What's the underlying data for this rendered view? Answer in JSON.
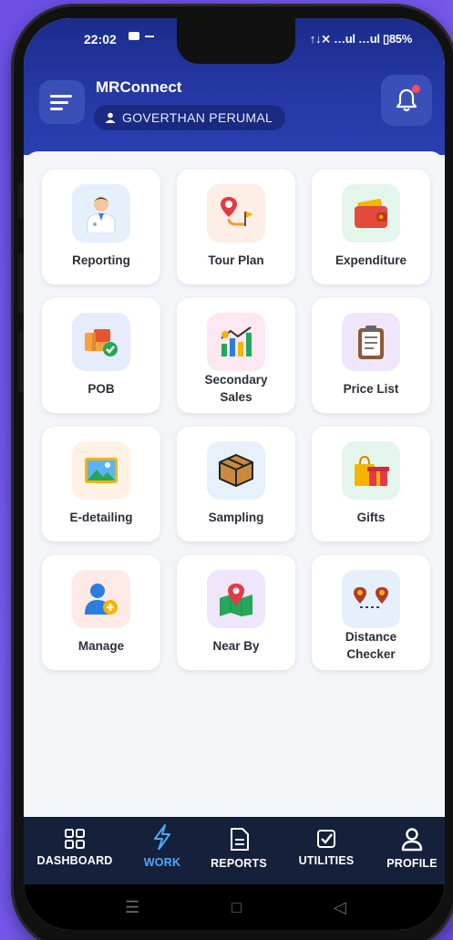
{
  "status": {
    "time": "22:02",
    "right_text": "↑↓⨯ …ul …ul ▯85%"
  },
  "header": {
    "app_title": "MRConnect",
    "user_name": "GOVERTHAN PERUMAL",
    "bell_has_notification": true
  },
  "tiles": [
    {
      "label": "Reporting",
      "icon": "doctor-icon",
      "bg": "#e6f0fb"
    },
    {
      "label": "Tour Plan",
      "icon": "route-pin-icon",
      "bg": "#fdeee6"
    },
    {
      "label": "Expenditure",
      "icon": "wallet-icon",
      "bg": "#e4f5ec"
    },
    {
      "label": "POB",
      "icon": "package-check-icon",
      "bg": "#e6ecfb"
    },
    {
      "label": "Secondary",
      "label2": "Sales",
      "icon": "bar-chart-icon",
      "bg": "#fbe8f0"
    },
    {
      "label": "Price List",
      "icon": "clipboard-icon",
      "bg": "#efe6fb"
    },
    {
      "label": "E-detailing",
      "icon": "image-icon",
      "bg": "#fdf2e4"
    },
    {
      "label": "Sampling",
      "icon": "box-icon",
      "bg": "#e6f1fb"
    },
    {
      "label": "Gifts",
      "icon": "gift-bag-icon",
      "bg": "#e4f5ec"
    },
    {
      "label": "Manage",
      "icon": "user-add-icon",
      "bg": "#fdeae6"
    },
    {
      "label": "Near By",
      "icon": "map-pin-icon",
      "bg": "#efe6fb"
    },
    {
      "label": "Distance",
      "label2": "Checker",
      "icon": "two-pins-icon",
      "bg": "#e6f0fb"
    }
  ],
  "nav": [
    {
      "label": "DASHBOARD",
      "icon": "grid-icon",
      "active": false
    },
    {
      "label": "WORK",
      "icon": "bolt-icon",
      "active": true
    },
    {
      "label": "REPORTS",
      "icon": "report-icon",
      "active": false
    },
    {
      "label": "UTILITIES",
      "icon": "checkbox-icon",
      "active": false
    },
    {
      "label": "PROFILE",
      "icon": "person-icon",
      "active": false
    }
  ],
  "colors": {
    "accent_active": "#4aa8ff",
    "header": "#2639a6",
    "nav_bg": "#15203a"
  }
}
